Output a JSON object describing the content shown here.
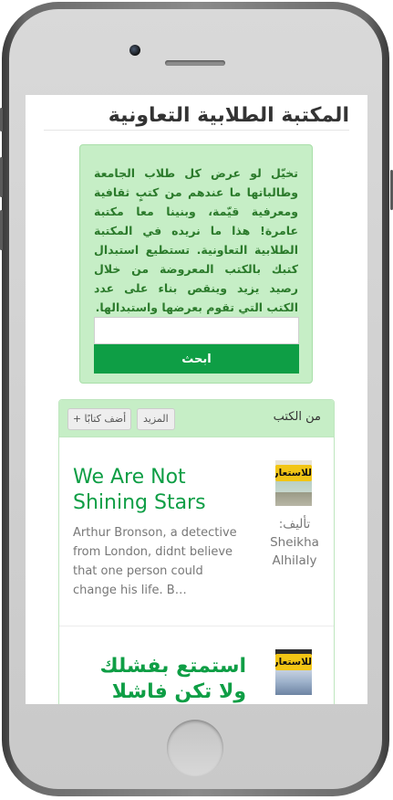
{
  "colors": {
    "accent": "#0e9e45",
    "panel_bg": "#c6eec6",
    "badge": "#f2c515"
  },
  "header": {
    "title": "المكتبة الطلابية التعاونية"
  },
  "hero": {
    "text": "تخيّل لو عرض كل طلاب الجامعة وطالباتها ما عندهم من كتبٍ ثقافية ومعرفية قيّمة، وبنينا معا مكتبة عامرة! هذا ما نريده في المكتبة الطلابية التعاونية. تستطيع استبدال كتبك بالكتب المعروضة من خلال رصيد يزيد وينقص بناء على عدد الكتب التي تقوم بعرضها واستبدالها.",
    "search_placeholder": "",
    "search_button": "ابحث"
  },
  "books_panel": {
    "title": "من الكتب",
    "more_label": "المزيد",
    "add_label": "أضف كتابًا"
  },
  "books": [
    {
      "badge": "للاستعارة",
      "author": "تأليف: Sheikha Alhilaly",
      "title": "We Are Not Shining Stars",
      "description": "Arthur Bronson, a detective from London, didnt believe that one person could change his life. B…"
    },
    {
      "badge": "للاستعارة",
      "title": "استمتع بفشلك ولا تكن فاشلا"
    }
  ]
}
